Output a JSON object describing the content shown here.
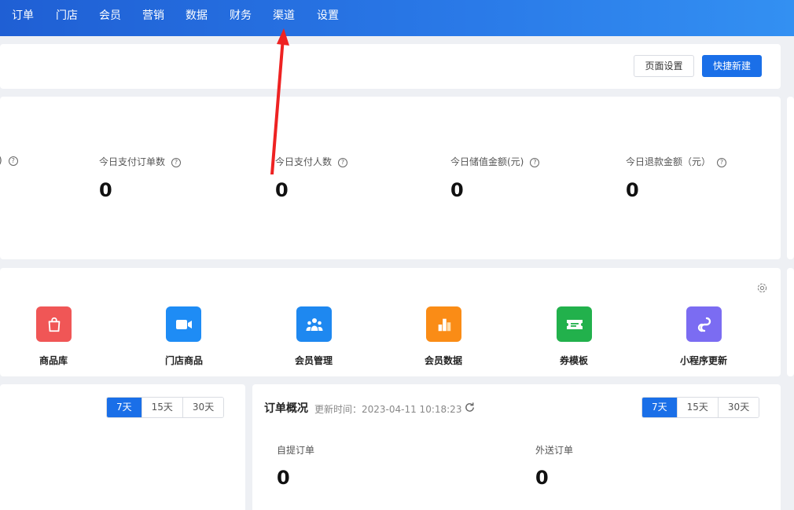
{
  "nav": {
    "items": [
      "订单",
      "门店",
      "会员",
      "营销",
      "数据",
      "财务",
      "渠道",
      "设置"
    ]
  },
  "header": {
    "page_settings_label": "页面设置",
    "quick_create_label": "快捷新建"
  },
  "stats": [
    {
      "label": ")",
      "value": ""
    },
    {
      "label": "今日支付订单数",
      "value": "0"
    },
    {
      "label": "今日支付人数",
      "value": "0"
    },
    {
      "label": "今日储值金额(元)",
      "value": "0"
    },
    {
      "label": "今日退款金额（元）",
      "value": "0"
    }
  ],
  "tiles": [
    {
      "label": "商品库",
      "icon": "shopping-bag-icon",
      "color": "#f05656"
    },
    {
      "label": "门店商品",
      "icon": "video-camera-icon",
      "color": "#1e8cf5"
    },
    {
      "label": "会员管理",
      "icon": "members-icon",
      "color": "#1e88f0"
    },
    {
      "label": "会员数据",
      "icon": "bar-chart-icon",
      "color": "#fa8c16"
    },
    {
      "label": "券模板",
      "icon": "ticket-icon",
      "color": "#22b14c"
    },
    {
      "label": "小程序更新",
      "icon": "link-icon",
      "color": "#7b6cf2"
    }
  ],
  "left_panel": {
    "ranges": [
      "7天",
      "15天",
      "30天"
    ],
    "active_range": "7天"
  },
  "order_overview": {
    "title": "订单概况",
    "updated_label": "更新时间：2023-04-11 10:18:23",
    "ranges": [
      "7天",
      "15天",
      "30天"
    ],
    "active_range": "7天",
    "pickup": {
      "label": "自提订单",
      "value": "0"
    },
    "delivery": {
      "label": "外送订单",
      "value": "0"
    }
  },
  "colors": {
    "primary": "#1a6fe8",
    "nav_start": "#1f5fd4",
    "nav_end": "#3390f2",
    "annotation_arrow": "#ee2222"
  }
}
